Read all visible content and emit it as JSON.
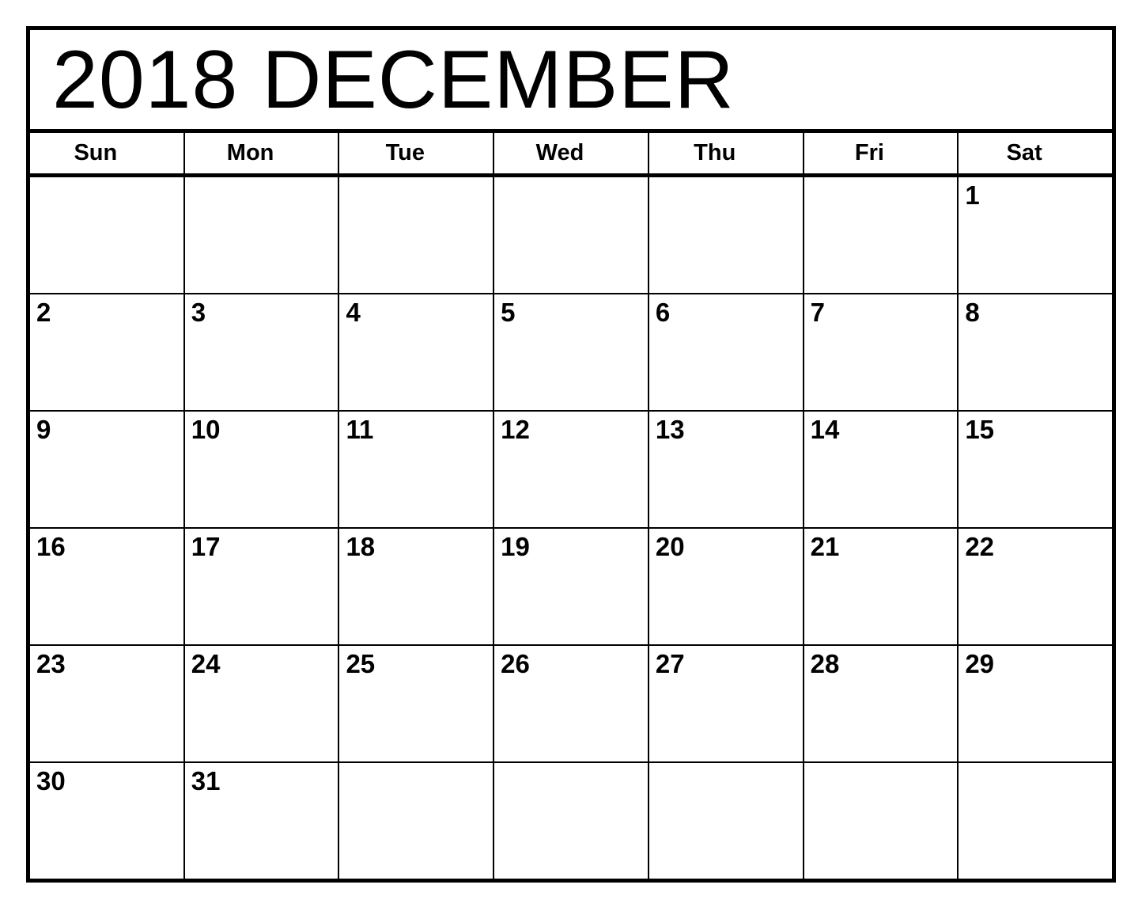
{
  "calendar": {
    "title": "2018 DECEMBER",
    "year": "2018",
    "month": "DECEMBER",
    "weekdays": [
      {
        "label": "Sun"
      },
      {
        "label": "Mon"
      },
      {
        "label": "Tue"
      },
      {
        "label": "Wed"
      },
      {
        "label": "Thu"
      },
      {
        "label": "Fri"
      },
      {
        "label": "Sat"
      }
    ],
    "weeks": [
      [
        {
          "day": "",
          "empty": true
        },
        {
          "day": "",
          "empty": true
        },
        {
          "day": "",
          "empty": true
        },
        {
          "day": "",
          "empty": true
        },
        {
          "day": "",
          "empty": true
        },
        {
          "day": "",
          "empty": true
        },
        {
          "day": "1",
          "empty": false
        }
      ],
      [
        {
          "day": "2",
          "empty": false
        },
        {
          "day": "3",
          "empty": false
        },
        {
          "day": "4",
          "empty": false
        },
        {
          "day": "5",
          "empty": false
        },
        {
          "day": "6",
          "empty": false
        },
        {
          "day": "7",
          "empty": false
        },
        {
          "day": "8",
          "empty": false
        }
      ],
      [
        {
          "day": "9",
          "empty": false
        },
        {
          "day": "10",
          "empty": false
        },
        {
          "day": "11",
          "empty": false
        },
        {
          "day": "12",
          "empty": false
        },
        {
          "day": "13",
          "empty": false
        },
        {
          "day": "14",
          "empty": false
        },
        {
          "day": "15",
          "empty": false
        }
      ],
      [
        {
          "day": "16",
          "empty": false
        },
        {
          "day": "17",
          "empty": false
        },
        {
          "day": "18",
          "empty": false
        },
        {
          "day": "19",
          "empty": false
        },
        {
          "day": "20",
          "empty": false
        },
        {
          "day": "21",
          "empty": false
        },
        {
          "day": "22",
          "empty": false
        }
      ],
      [
        {
          "day": "23",
          "empty": false
        },
        {
          "day": "24",
          "empty": false
        },
        {
          "day": "25",
          "empty": false
        },
        {
          "day": "26",
          "empty": false
        },
        {
          "day": "27",
          "empty": false
        },
        {
          "day": "28",
          "empty": false
        },
        {
          "day": "29",
          "empty": false
        }
      ],
      [
        {
          "day": "30",
          "empty": false
        },
        {
          "day": "31",
          "empty": false
        },
        {
          "day": "",
          "empty": true
        },
        {
          "day": "",
          "empty": true
        },
        {
          "day": "",
          "empty": true
        },
        {
          "day": "",
          "empty": true
        },
        {
          "day": "",
          "empty": true
        }
      ]
    ]
  },
  "footer": {
    "note": ""
  },
  "colors": {
    "ink": "#000000",
    "paper": "#ffffff",
    "watermark": "#fbfbfb"
  }
}
